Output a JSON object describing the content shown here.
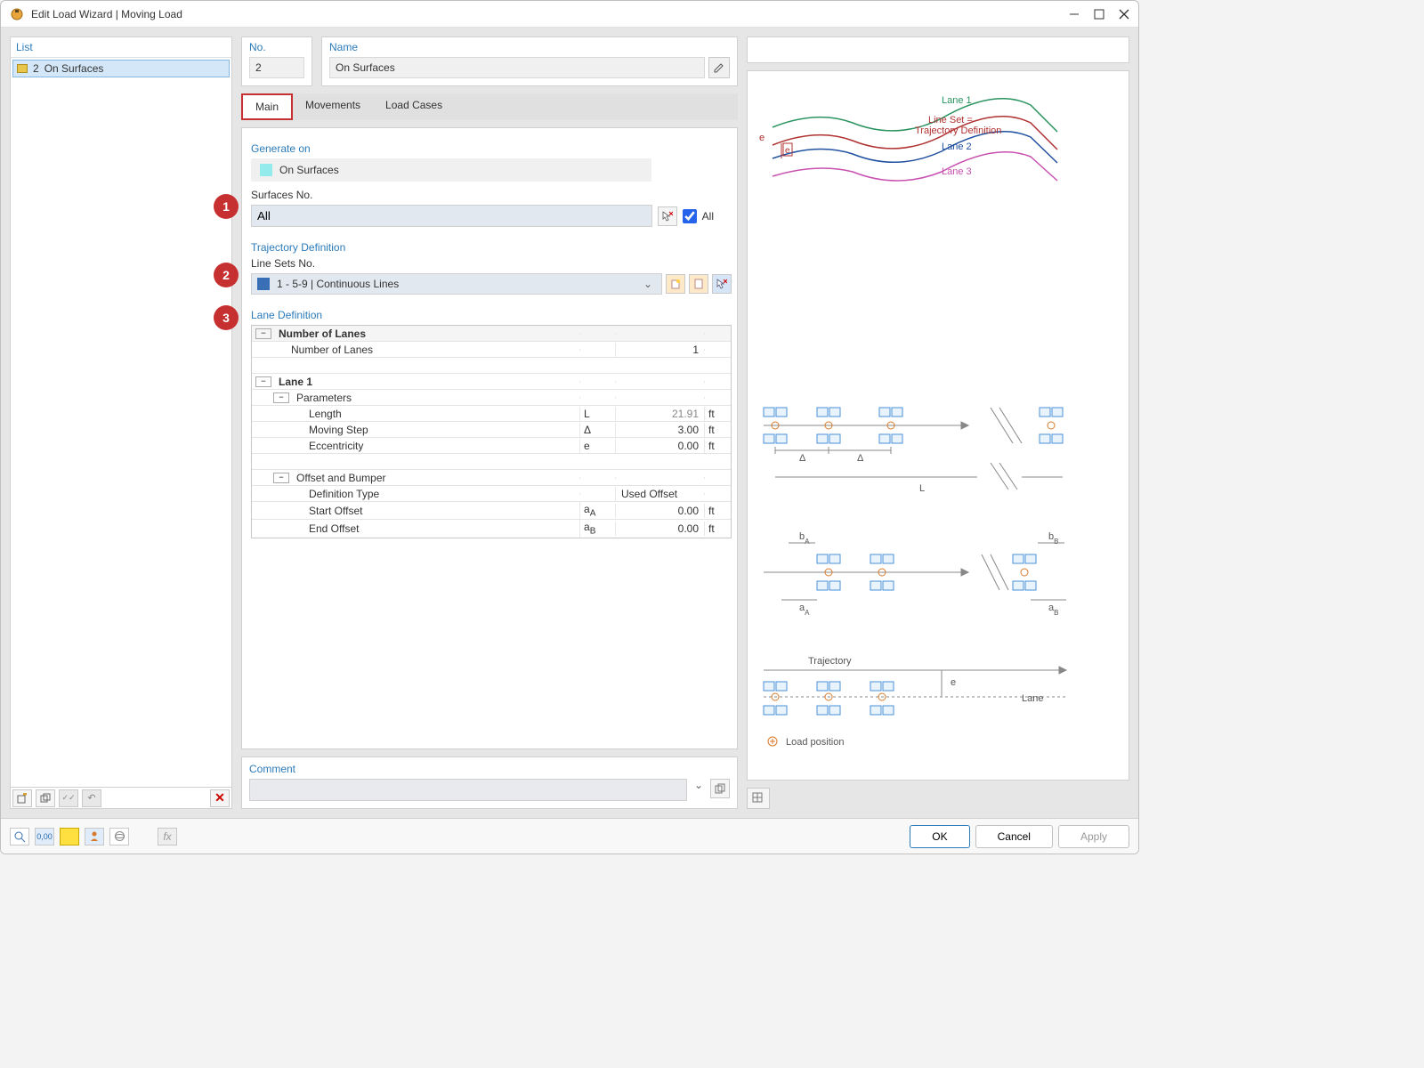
{
  "window": {
    "title": "Edit Load Wizard | Moving Load"
  },
  "list": {
    "header": "List",
    "items": [
      {
        "num": "2",
        "label": "On Surfaces"
      }
    ]
  },
  "fields": {
    "no_label": "No.",
    "no_value": "2",
    "name_label": "Name",
    "name_value": "On Surfaces"
  },
  "tabs": {
    "main": "Main",
    "movements": "Movements",
    "load_cases": "Load Cases"
  },
  "callouts": {
    "c1": "1",
    "c2": "2",
    "c3": "3"
  },
  "generate": {
    "section": "Generate on",
    "target": "On Surfaces",
    "surfaces_label": "Surfaces No.",
    "surfaces_value": "All",
    "all_label": "All"
  },
  "trajectory": {
    "section": "Trajectory Definition",
    "linesets_label": "Line Sets No.",
    "linesets_value": "1 - 5-9 | Continuous Lines"
  },
  "lane": {
    "section": "Lane Definition",
    "rows": {
      "num_lanes_hdr": "Number of Lanes",
      "num_lanes_label": "Number of Lanes",
      "num_lanes_val": "1",
      "lane1": "Lane 1",
      "parameters": "Parameters",
      "length_label": "Length",
      "length_sym": "L",
      "length_val": "21.91",
      "length_unit": "ft",
      "step_label": "Moving Step",
      "step_sym": "Δ",
      "step_val": "3.00",
      "step_unit": "ft",
      "ecc_label": "Eccentricity",
      "ecc_sym": "e",
      "ecc_val": "0.00",
      "ecc_unit": "ft",
      "offset_hdr": "Offset and Bumper",
      "deftype_label": "Definition Type",
      "deftype_val": "Used Offset",
      "startoff_label": "Start Offset",
      "startoff_sym": "aA",
      "startoff_val": "0.00",
      "startoff_unit": "ft",
      "endoff_label": "End Offset",
      "endoff_sym": "aB",
      "endoff_val": "0.00",
      "endoff_unit": "ft"
    }
  },
  "comment": {
    "label": "Comment",
    "value": ""
  },
  "diagram_labels": {
    "e": "e",
    "lane1": "Lane 1",
    "lineset": "Line Set =",
    "trajdef": "Trajectory Definition",
    "lane2": "Lane 2",
    "lane3": "Lane 3",
    "delta": "Δ",
    "L": "L",
    "bA": "bA",
    "bB": "bB",
    "aA": "aA",
    "aB": "aB",
    "trajectory": "Trajectory",
    "lane": "Lane",
    "loadpos": "Load position"
  },
  "buttons": {
    "ok": "OK",
    "cancel": "Cancel",
    "apply": "Apply"
  },
  "chart_data": {
    "type": "table",
    "title": "Lane 1 Parameters",
    "series": [
      {
        "name": "Length (ft)",
        "values": [
          21.91
        ]
      },
      {
        "name": "Moving Step (ft)",
        "values": [
          3.0
        ]
      },
      {
        "name": "Eccentricity (ft)",
        "values": [
          0.0
        ]
      },
      {
        "name": "Start Offset (ft)",
        "values": [
          0.0
        ]
      },
      {
        "name": "End Offset (ft)",
        "values": [
          0.0
        ]
      },
      {
        "name": "Number of Lanes",
        "values": [
          1
        ]
      }
    ]
  }
}
